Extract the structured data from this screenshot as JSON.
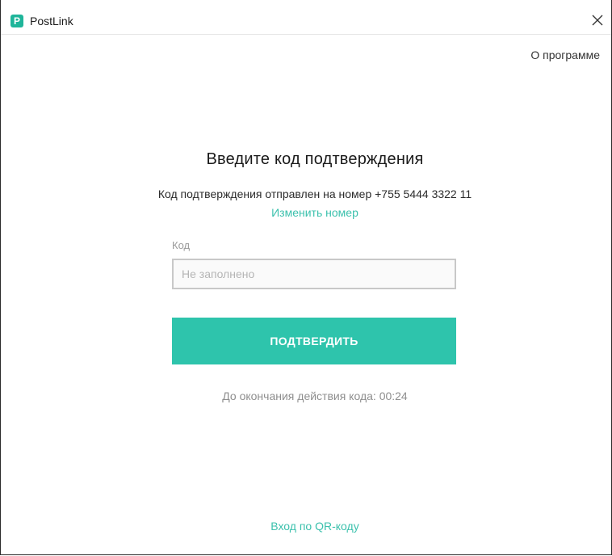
{
  "window": {
    "title": "PostLink",
    "icon": "postlink-logo-icon",
    "close_icon": "close-icon"
  },
  "header": {
    "about_label": "О программе"
  },
  "main": {
    "heading": "Введите код подтверждения",
    "sent_text": "Код подтверждения отправлен на номер +755  5444 3322 11",
    "change_number_label": "Изменить номер",
    "code_label": "Код",
    "code_placeholder": "Не заполнено",
    "code_value": "",
    "confirm_label": "ПОДТВЕРДИТЬ",
    "timer_prefix": "До окончания действия кода:",
    "timer_value": "00:24",
    "qr_login_label": "Вход по QR-коду"
  },
  "colors": {
    "accent": "#2ec4ac",
    "link": "#3cc1ad"
  }
}
